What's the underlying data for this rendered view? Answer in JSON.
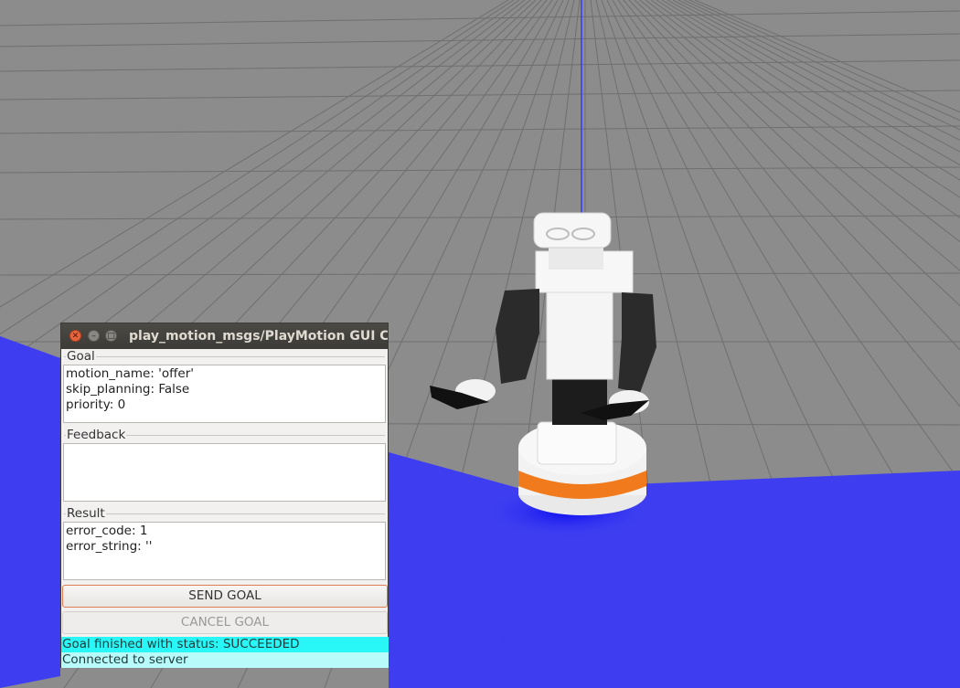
{
  "window": {
    "title": "play_motion_msgs/PlayMotion GUI Cli"
  },
  "goal": {
    "label": "Goal",
    "lines": [
      "motion_name: 'offer'",
      "skip_planning: False",
      "priority: 0"
    ]
  },
  "feedback": {
    "label": "Feedback",
    "lines": []
  },
  "result": {
    "label": "Result",
    "lines": [
      "error_code: 1",
      "error_string: ''"
    ]
  },
  "buttons": {
    "send_goal": "SEND GOAL",
    "cancel_goal": "CANCEL GOAL"
  },
  "status": {
    "goal_status": "Goal finished with status: SUCCEEDED",
    "connection": "Connected to server"
  },
  "colors": {
    "floor_grid": "#8c8c8c",
    "laser_scan": "#3a3af5",
    "robot_accent": "#f07a1c",
    "status_primary": "#29f6f6",
    "status_secondary": "#b7fbfb",
    "send_button_border": "#e07b53"
  },
  "icons": [
    "close-icon",
    "minimize-icon",
    "maximize-icon"
  ]
}
